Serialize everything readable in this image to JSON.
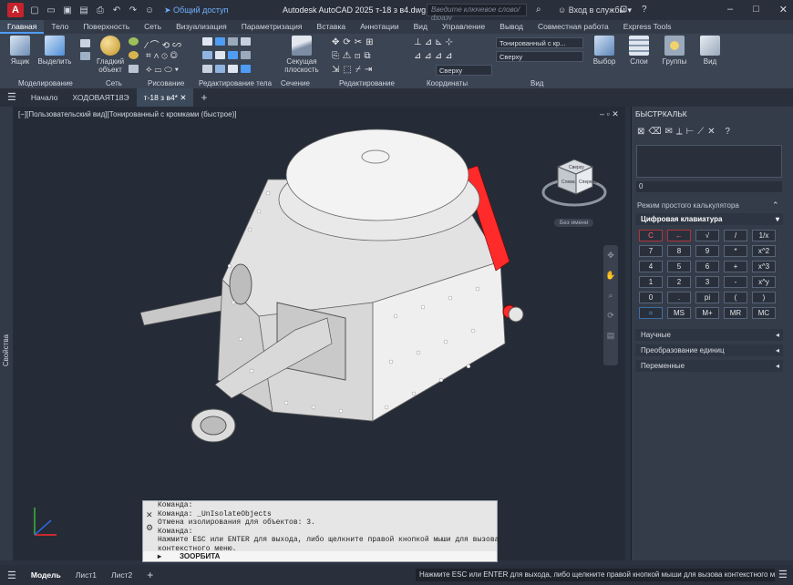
{
  "titlebar": {
    "app_logo": "A",
    "share_label": "Общий доступ",
    "title": "Autodesk AutoCAD 2025    т-18 з в4.dwg",
    "search_placeholder": "Введите ключевое слово/фразу",
    "login_label": "Вход в службы"
  },
  "ribbon_tabs": [
    "Главная",
    "Тело",
    "Поверхность",
    "Сеть",
    "Визуализация",
    "Параметризация",
    "Вставка",
    "Аннотации",
    "Вид",
    "Управление",
    "Вывод",
    "Совместная работа",
    "Express Tools"
  ],
  "ribbon": {
    "box_label": "Ящик",
    "select_label": "Выделить",
    "smooth_label": "Гладкий объект",
    "section_plane_label": "Секущая плоскость",
    "visual_style": "Тонированный с кр...",
    "view_top": "Сверху",
    "ucs_top": "Сверху",
    "select_big": "Выбор",
    "layers_big": "Слои",
    "groups_big": "Группы",
    "view_big": "Вид",
    "panels": [
      "Моделирование",
      "Сеть",
      "Рисование",
      "Редактирование тела",
      "Сечение",
      "Редактирование",
      "Координаты",
      "Вид"
    ]
  },
  "doc_tabs": [
    "Начало",
    "ХОДОВАЯТ18Э",
    "т-18 з в4*"
  ],
  "viewport": {
    "label": "[−][Пользовательский вид][Тонированный с кромками (быстрое)]",
    "viewcube_name": "Без имени",
    "cube_faces": [
      "Сверху",
      "Слева",
      "Спереди"
    ],
    "accent": "#ff2a2a"
  },
  "sidebar_left": "Свойства",
  "calc": {
    "title": "БЫСТРКАЛЬК",
    "value": "0",
    "mode": "Режим простого калькулятора",
    "keypad_title": "Цифровая клавиатура",
    "keys": [
      "C",
      "←",
      "√",
      "/",
      "1/x",
      "7",
      "8",
      "9",
      "*",
      "x^2",
      "4",
      "5",
      "6",
      "+",
      "x^3",
      "1",
      "2",
      "3",
      "-",
      "x^y",
      "0",
      ".",
      "pi",
      "(",
      ")",
      "=",
      "MS",
      "M+",
      "MR",
      "MC"
    ],
    "sections": [
      "Научные",
      "Преобразование единиц",
      "Переменные"
    ]
  },
  "command": {
    "lines": [
      "Команда:",
      "Команда: _UnIsolateObjects",
      "Отмена изолирования для объектов: 3.",
      "Команда:",
      "Нажмите ESC или ENTER для выхода, либо щелкните правой кнопкой мыши для вызова",
      "контекстного меню."
    ],
    "input": "ЗООРБИТА"
  },
  "status": {
    "layouts": [
      "Модель",
      "Лист1",
      "Лист2"
    ],
    "message": "Нажмите ESC или ENTER для выхода, либо щелкните правой кнопкой мыши для вызова контекстного меню."
  }
}
